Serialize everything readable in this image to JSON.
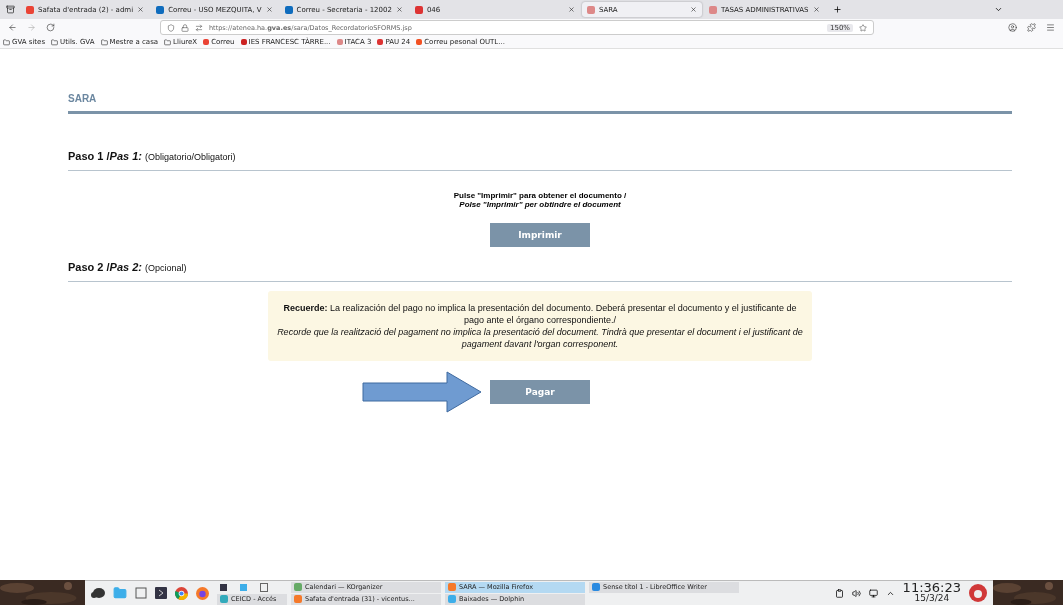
{
  "browser": {
    "tabs": [
      {
        "label": "Safata d'entrada (2) - admi",
        "kind": "gmail",
        "selected": false
      },
      {
        "label": "Correu - USO MEZQUITA, V",
        "kind": "outlook",
        "selected": false
      },
      {
        "label": "Correu - Secretaria - 12002",
        "kind": "outlook",
        "selected": false
      },
      {
        "label": "046",
        "kind": "gva",
        "selected": false
      },
      {
        "label": "SARA",
        "kind": "sara",
        "selected": true
      },
      {
        "label": "TASAS ADMINISTRATIVAS",
        "kind": "sara",
        "selected": false
      }
    ],
    "url": "https://atenea.ha.**gva.es**/sara/Datos_RecordatorioSFORMS.jsp",
    "zoom": "150%",
    "bookmarks": [
      {
        "label": "GVA sites",
        "kind": "folder"
      },
      {
        "label": "Utils. GVA",
        "kind": "folder"
      },
      {
        "label": "Mestre a casa",
        "kind": "folder"
      },
      {
        "label": "LliureX",
        "kind": "folder"
      },
      {
        "label": "Correu",
        "kind": "gmail"
      },
      {
        "label": "IES FRANCESC TÀRRE...",
        "kind": "school"
      },
      {
        "label": "ITACA 3",
        "kind": "sara"
      },
      {
        "label": "PAU 24",
        "kind": "gva"
      },
      {
        "label": "Correu pesonal OUTL...",
        "kind": "windows"
      }
    ]
  },
  "page": {
    "title": "SARA",
    "steps": [
      {
        "heading": "Paso 1 /*Pas 1:*",
        "note": "(Obligatorio/Obligatori)",
        "kind": "print",
        "lines": [
          "Pulse \"Imprimir\" para obtener el documento /",
          "Polse \"Imprimir\" per obtindre el document"
        ],
        "button": "Imprimir"
      },
      {
        "heading": "Paso 2 /*Pas 2:*",
        "note": "(Opcional)",
        "kind": "pay",
        "notice": [
          "**Recuerde:** La realización del pago no implica la presentación del documento. Deberá presentar el documento y el justificante de pago ante el órgano correspondiente./",
          "Recorde que la realització del pagament no implica la presentació del document. Tindrà que presentar el document i el justificant de pagament davant l'organ corresponent."
        ],
        "button": "Pagar"
      }
    ]
  },
  "taskbar": {
    "tasks": [
      {
        "label": "Calendari — KOrganizer",
        "kind": "calendar",
        "selected": false
      },
      {
        "label": "SARA — Mozilla Firefox",
        "kind": "firefox",
        "selected": true
      },
      {
        "label": "Sense títol 1 - LibreOffice Writer",
        "kind": "writer",
        "selected": false
      },
      {
        "label": "CEICD - Accés",
        "kind": "globe",
        "selected": false
      },
      {
        "label": "Safata d'entrada (31) - vicentus...",
        "kind": "firefox",
        "selected": false
      },
      {
        "label": "Baixades — Dolphin",
        "kind": "folder",
        "selected": false
      }
    ],
    "time": "11:36:23",
    "date": "15/3/24"
  }
}
